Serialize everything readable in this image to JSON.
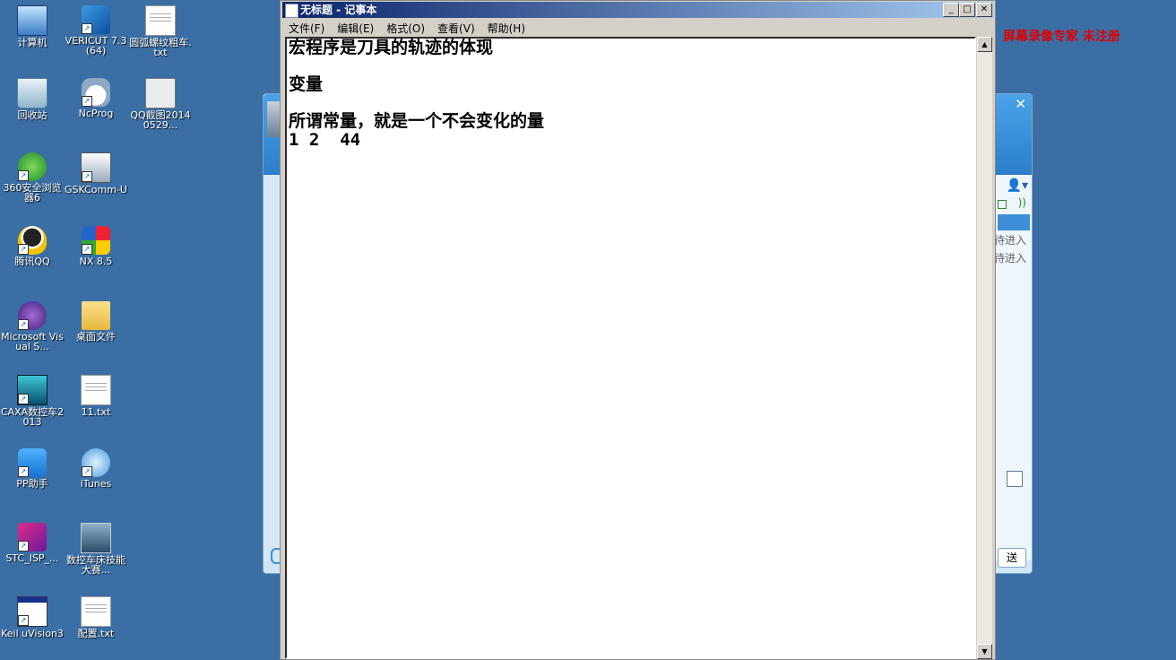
{
  "desktop": {
    "icons": [
      {
        "label": "计算机",
        "icon": "computer-icon"
      },
      {
        "label": "VERICUT 7.3 (64)",
        "icon": "vericut-icon"
      },
      {
        "label": "圆弧螺纹粗车.txt",
        "icon": "text-file-icon"
      },
      {
        "label": "回收站",
        "icon": "recycle-bin-icon"
      },
      {
        "label": "NcProg",
        "icon": "ncprog-icon"
      },
      {
        "label": "QQ截图20140529...",
        "icon": "image-file-icon"
      },
      {
        "label": "360安全浏览器6",
        "icon": "browser-360-icon"
      },
      {
        "label": "GSKComm-U",
        "icon": "gskcomm-icon"
      },
      {
        "label": "腾讯QQ",
        "icon": "qq-icon"
      },
      {
        "label": "NX 8.5",
        "icon": "nx-icon"
      },
      {
        "label": "Microsoft Visual S...",
        "icon": "visual-studio-icon"
      },
      {
        "label": "桌面文件",
        "icon": "folder-icon"
      },
      {
        "label": "CAXA数控车2013",
        "icon": "caxa-icon"
      },
      {
        "label": "11.txt",
        "icon": "text-file-icon"
      },
      {
        "label": "PP助手",
        "icon": "pp-assistant-icon"
      },
      {
        "label": "iTunes",
        "icon": "itunes-icon"
      },
      {
        "label": "STC_ISP_...",
        "icon": "stc-isp-icon"
      },
      {
        "label": "数控车床技能大赛...",
        "icon": "document-icon"
      },
      {
        "label": "Keil uVision3",
        "icon": "keil-icon"
      },
      {
        "label": "配置.txt",
        "icon": "text-file-icon"
      }
    ]
  },
  "notepad": {
    "title": "无标题 - 记事本",
    "menu": [
      "文件(F)",
      "编辑(E)",
      "格式(O)",
      "查看(V)",
      "帮助(H)"
    ],
    "content": "宏程序是刀具的轨迹的体现\n\n变量\n\n所谓常量，就是一个不会变化的量\n1 2  44"
  },
  "background_window": {
    "wait_texts": [
      "待进入",
      "待进入"
    ],
    "send_label": "送"
  },
  "watermark": "屏幕录像专家  未注册"
}
